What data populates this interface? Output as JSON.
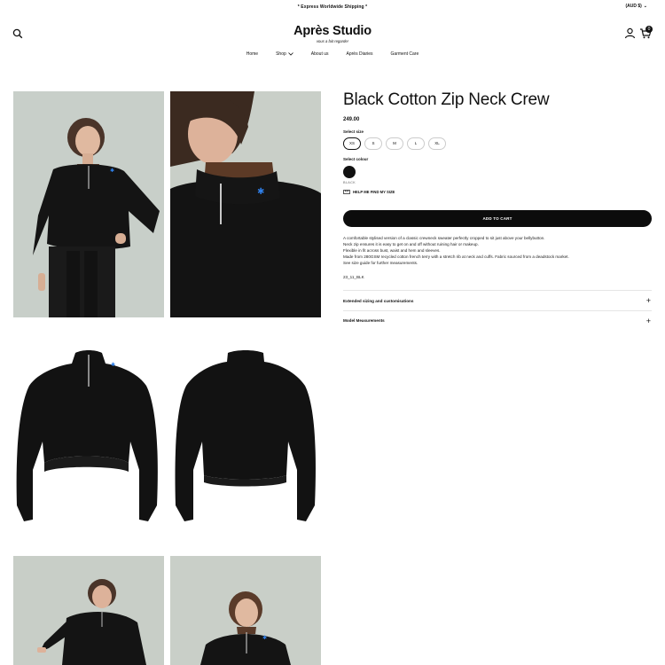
{
  "announcement": {
    "text": "* Express Worldwide Shipping *"
  },
  "currency": {
    "label": "(AUD $)",
    "chevron": "⌄"
  },
  "header": {
    "logo": "Après Studio",
    "tagline": "vous a fait regarder",
    "cart_count": "0",
    "icons": [
      "search-icon",
      "account-icon",
      "cart-icon"
    ]
  },
  "nav": {
    "items": [
      "Home",
      "Shop",
      "About us",
      "Après Diaries",
      "Garment Care"
    ]
  },
  "product": {
    "title": "Black Cotton Zip Neck Crew",
    "price": "249.00",
    "size_label": "Select size",
    "sizes": [
      "XS",
      "S",
      "M",
      "L",
      "XL"
    ],
    "selected_size": "XS",
    "colour_label": "Select colour",
    "colour_name": "BLACK",
    "help_text": "HELP ME FIND MY SIZE",
    "add_to_cart": "ADD TO CART",
    "description": [
      "A comfortable stylised version of a classic crewneck sweater perfectly cropped to sit just above your bellybutton.",
      "Neck zip ensures it is easy to get on and off without ruining hair or makeup.",
      "Flexible in fit across bust, waist and hem and sleeves.",
      "Made from 280GSM recycled cotton french terry with a stretch rib at neck and cuffs. Fabric sourced from a deadstock market.",
      "See size guide for further measurements."
    ],
    "sku": "23_11_BLK",
    "accordions": [
      "Extended sizing and customisations",
      "Model Measurements"
    ]
  },
  "colors": {
    "accent": "#0c0c0c",
    "photo_bg": "#c9d0ca",
    "zip_star": "#2f7fe8"
  }
}
